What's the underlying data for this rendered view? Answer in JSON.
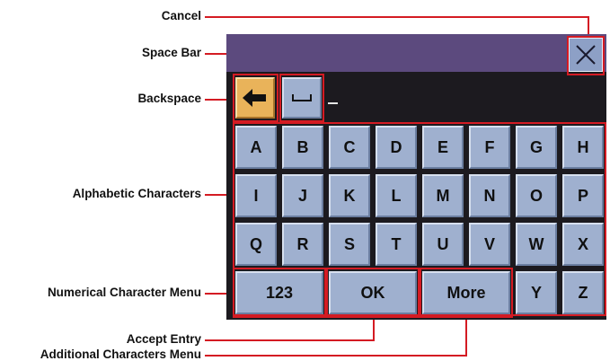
{
  "callouts": {
    "cancel": "Cancel",
    "space_bar": "Space Bar",
    "backspace": "Backspace",
    "alphabetic": "Alphabetic Characters",
    "numerical": "Numerical Character Menu",
    "accept": "Accept Entry",
    "additional": "Additional Characters Menu"
  },
  "keyboard": {
    "rows": [
      [
        "A",
        "B",
        "C",
        "D",
        "E",
        "F",
        "G",
        "H"
      ],
      [
        "I",
        "J",
        "K",
        "L",
        "M",
        "N",
        "O",
        "P"
      ],
      [
        "Q",
        "R",
        "S",
        "T",
        "U",
        "V",
        "W",
        "X"
      ]
    ],
    "bottom": {
      "numbers": "123",
      "ok": "OK",
      "more": "More",
      "y": "Y",
      "z": "Z"
    }
  },
  "colors": {
    "accent": "#d41b23",
    "titlebar": "#5c4a7e",
    "key": "#9fb0cf",
    "backspace": "#e9b35a"
  },
  "icons": {
    "cancel": "close-icon",
    "backspace": "arrow-left-icon",
    "space": "space-bar-icon"
  }
}
